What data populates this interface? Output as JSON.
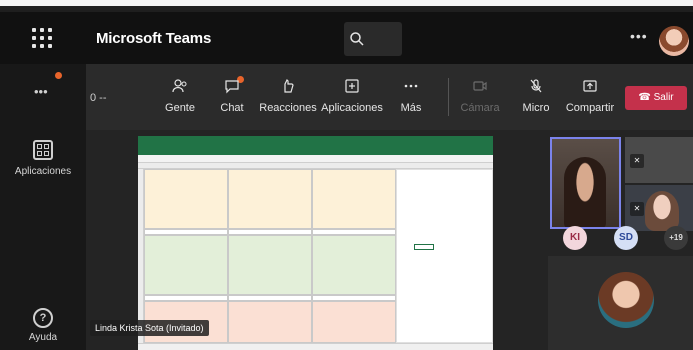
{
  "header": {
    "app_title": "Microsoft Teams"
  },
  "rail": {
    "apps_label": "Aplicaciones",
    "help_label": "Ayuda"
  },
  "toolbar": {
    "timer": "0 --",
    "items": [
      {
        "label": "Gente",
        "icon": "people-icon"
      },
      {
        "label": "Chat",
        "icon": "chat-icon"
      },
      {
        "label": "Reacciones",
        "icon": "reactions-icon"
      },
      {
        "label": "Aplicaciones",
        "icon": "add-apps-icon"
      },
      {
        "label": "Más",
        "icon": "more-icon"
      },
      {
        "label": "Cámara",
        "icon": "camera-off-icon",
        "disabled": true
      },
      {
        "label": "Micro",
        "icon": "mic-off-icon"
      },
      {
        "label": "Compartir",
        "icon": "share-icon"
      }
    ],
    "leave_label": "Salir"
  },
  "stage": {
    "presenter_name": "Linda Krista Sota (Invitado)"
  },
  "participants": {
    "bubbles": [
      "KI",
      "SD",
      "+19"
    ]
  },
  "colors": {
    "accent": "#7b83eb",
    "leave": "#c4314b",
    "excel_green": "#217346",
    "notification": "#e8642b"
  }
}
